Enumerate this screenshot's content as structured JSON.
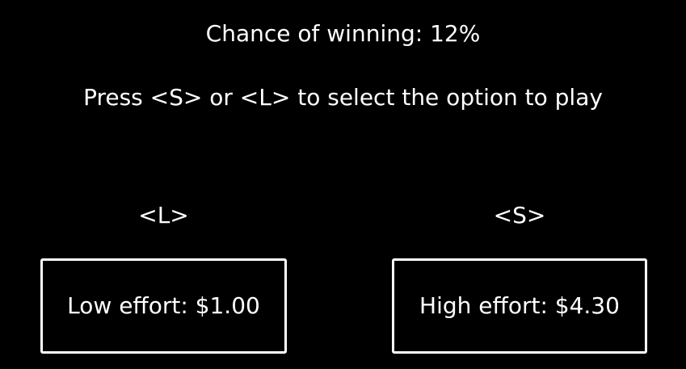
{
  "status": {
    "chance_text": "Chance of winning: 12%"
  },
  "instruction": "Press <S> or <L> to select the option to play",
  "options": {
    "left": {
      "key": "<L>",
      "label": "Low effort: $1.00"
    },
    "right": {
      "key": "<S>",
      "label": "High effort: $4.30"
    }
  },
  "colors": {
    "background": "#000000",
    "text": "#ffffff",
    "border": "#ffffff"
  }
}
